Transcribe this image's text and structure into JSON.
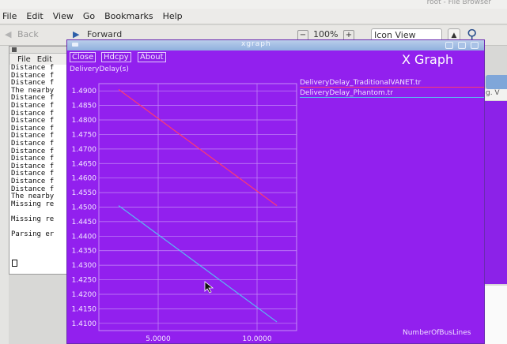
{
  "file_manager": {
    "title": "root - File Browser",
    "menu": [
      "File",
      "Edit",
      "View",
      "Go",
      "Bookmarks",
      "Help"
    ],
    "toolbar": {
      "back_label": "Back",
      "forward_label": "Forward",
      "zoom_level": "100%",
      "view_mode": "Icon View"
    },
    "right_partial_label": "g. V"
  },
  "terminal": {
    "menu": [
      "File",
      "Edit"
    ],
    "lines": [
      "Distance f",
      "Distance f",
      "Distance f",
      "The nearby",
      "Distance f",
      "Distance f",
      "Distance f",
      "Distance f",
      "Distance f",
      "Distance f",
      "Distance f",
      "Distance f",
      "Distance f",
      "Distance f",
      "Distance f",
      "Distance f",
      "Distance f",
      "The nearby",
      "Missing re",
      "",
      "Missing re",
      "",
      "Parsing er"
    ]
  },
  "xgraph": {
    "window_title": "xgraph",
    "buttons": {
      "close": "Close",
      "hdcpy": "Hdcpy",
      "about": "About"
    },
    "brand": "X Graph",
    "colors": {
      "background": "#9220ee",
      "series_0": "#ff3a6e",
      "series_1": "#5ab8f0",
      "grid": "#c58cf6"
    }
  },
  "chart_data": {
    "type": "line",
    "ylabel": "DeliveryDelay(s)",
    "xlabel": "NumberOfBusLines",
    "ylim": [
      1.4075,
      1.4925
    ],
    "xlim": [
      2,
      12
    ],
    "yticks": [
      "1.4900",
      "1.4850",
      "1.4800",
      "1.4750",
      "1.4700",
      "1.4650",
      "1.4600",
      "1.4550",
      "1.4500",
      "1.4450",
      "1.4400",
      "1.4350",
      "1.4300",
      "1.4250",
      "1.4200",
      "1.4150",
      "1.4100"
    ],
    "xticks": [
      "5.0000",
      "10.0000"
    ],
    "grid": true,
    "legend_placement": "right",
    "series": [
      {
        "name": "DeliveryDelay_TraditionalVANET.tr",
        "color": "#ff3a6e",
        "x": [
          3,
          11
        ],
        "y": [
          1.4905,
          1.4505
        ]
      },
      {
        "name": "DeliveryDelay_Phantom.tr",
        "color": "#5ab8f0",
        "x": [
          3,
          11
        ],
        "y": [
          1.4505,
          1.4105
        ]
      }
    ]
  }
}
